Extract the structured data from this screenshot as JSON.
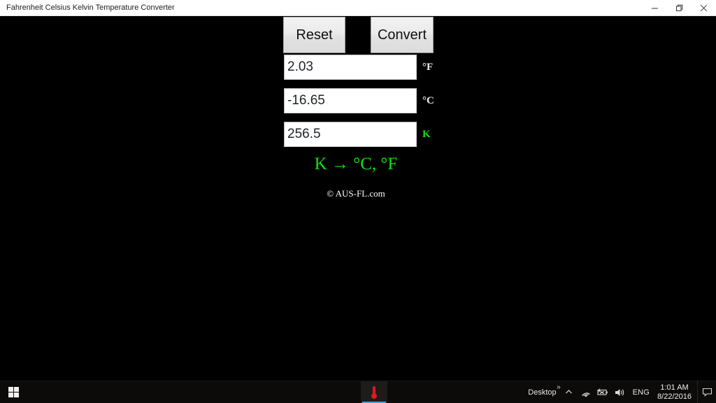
{
  "window": {
    "title": "Fahrenheit Celsius Kelvin Temperature Converter",
    "controls": {
      "minimize": "minimize-icon",
      "restore": "restore-icon",
      "close": "close-icon"
    }
  },
  "app": {
    "buttons": {
      "reset": "Reset",
      "convert": "Convert"
    },
    "fields": [
      {
        "id": "fahrenheit",
        "value": "2.03",
        "placeholder": "",
        "unit": "°F",
        "unit_color": "#f0f0f0"
      },
      {
        "id": "celsius",
        "value": "-16.65",
        "placeholder": "",
        "unit": "°C",
        "unit_color": "#f0f0f0"
      },
      {
        "id": "kelvin",
        "value": "256.5",
        "placeholder": "",
        "unit": "K",
        "unit_color": "#12e012"
      }
    ],
    "formula": "K → °C, °F",
    "copyright": "© AUS-FL.com",
    "colors": {
      "background": "#000000",
      "accent_green": "#12e012",
      "button_face": "#e9e9e9"
    }
  },
  "taskbar": {
    "start": "start-button",
    "apps": [
      {
        "name": "temperature-converter",
        "icon": "thermometer-icon",
        "active": true
      }
    ],
    "tray": {
      "desktop_label": "Desktop",
      "overflow": "chevron-up-icon",
      "network": "wifi-icon",
      "battery": "battery-icon",
      "volume": "speaker-icon",
      "language": "ENG",
      "time": "1:01 AM",
      "date": "8/22/2016",
      "action_center": "action-center-icon"
    }
  }
}
